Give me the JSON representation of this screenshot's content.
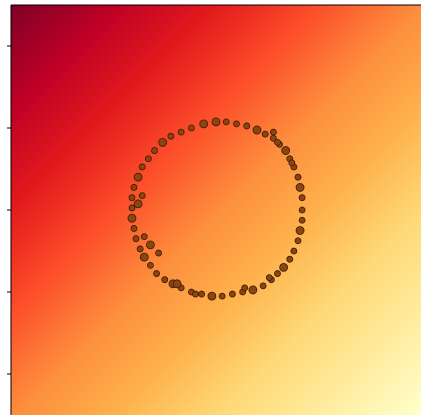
{
  "chart_data": {
    "type": "scatter",
    "title": "",
    "xlabel": "",
    "ylabel": "",
    "xlim": [
      -1,
      1
    ],
    "ylim": [
      -1,
      1
    ],
    "y_ticks": [
      0.8,
      0.4,
      0.0,
      -0.4,
      -0.8
    ],
    "tick_labels_shown": false,
    "grid": false,
    "legend": "none",
    "background": {
      "type": "heatmap",
      "description_value": "x - y",
      "range": [
        -2,
        2
      ],
      "colormap": "YlOrRd_r",
      "colors": [
        "#800026",
        "#bd0026",
        "#e31a1c",
        "#fc4e2a",
        "#fd8d3c",
        "#feb24c",
        "#fed976",
        "#ffeda0",
        "#ffffcc"
      ]
    },
    "series": [
      {
        "marker_color": "#8b4513",
        "marker_edge_color": "#3a1a06",
        "points": [
          [
            0.0,
            0.43
          ],
          [
            0.05,
            0.43
          ],
          [
            0.1,
            0.42
          ],
          [
            0.15,
            0.41
          ],
          [
            0.2,
            0.39
          ],
          [
            0.24,
            0.37
          ],
          [
            0.28,
            0.35
          ],
          [
            0.31,
            0.32
          ],
          [
            0.34,
            0.29
          ],
          [
            0.36,
            0.25
          ],
          [
            0.38,
            0.21
          ],
          [
            0.4,
            0.16
          ],
          [
            0.41,
            0.11
          ],
          [
            0.42,
            0.06
          ],
          [
            0.42,
            0.0
          ],
          [
            0.42,
            -0.05
          ],
          [
            0.41,
            -0.1
          ],
          [
            0.4,
            -0.15
          ],
          [
            0.38,
            -0.2
          ],
          [
            0.36,
            -0.24
          ],
          [
            0.33,
            -0.28
          ],
          [
            0.3,
            -0.31
          ],
          [
            0.27,
            -0.34
          ],
          [
            0.23,
            -0.37
          ],
          [
            0.18,
            -0.39
          ],
          [
            0.13,
            -0.4
          ],
          [
            0.08,
            -0.41
          ],
          [
            0.03,
            -0.42
          ],
          [
            -0.02,
            -0.42
          ],
          [
            -0.07,
            -0.41
          ],
          [
            -0.12,
            -0.4
          ],
          [
            -0.17,
            -0.38
          ],
          [
            -0.21,
            -0.36
          ],
          [
            -0.25,
            -0.34
          ],
          [
            -0.29,
            -0.31
          ],
          [
            -0.32,
            -0.27
          ],
          [
            -0.35,
            -0.23
          ],
          [
            -0.37,
            -0.19
          ],
          [
            -0.39,
            -0.14
          ],
          [
            -0.4,
            -0.09
          ],
          [
            -0.41,
            -0.04
          ],
          [
            -0.41,
            0.01
          ],
          [
            -0.41,
            0.06
          ],
          [
            -0.4,
            0.11
          ],
          [
            -0.38,
            0.16
          ],
          [
            -0.36,
            0.21
          ],
          [
            -0.33,
            0.25
          ],
          [
            -0.3,
            0.29
          ],
          [
            -0.26,
            0.33
          ],
          [
            -0.22,
            0.36
          ],
          [
            -0.17,
            0.38
          ],
          [
            -0.12,
            0.4
          ],
          [
            -0.06,
            0.42
          ],
          [
            0.28,
            0.38
          ],
          [
            0.3,
            0.33
          ],
          [
            -0.28,
            -0.21
          ],
          [
            -0.32,
            -0.17
          ],
          [
            -0.35,
            -0.13
          ],
          [
            0.26,
            -0.33
          ],
          [
            0.14,
            -0.38
          ],
          [
            -0.19,
            -0.36
          ],
          [
            -0.1,
            -0.41
          ],
          [
            0.37,
            0.23
          ],
          [
            -0.36,
            0.07
          ],
          [
            -0.38,
            0.03
          ]
        ]
      }
    ]
  }
}
